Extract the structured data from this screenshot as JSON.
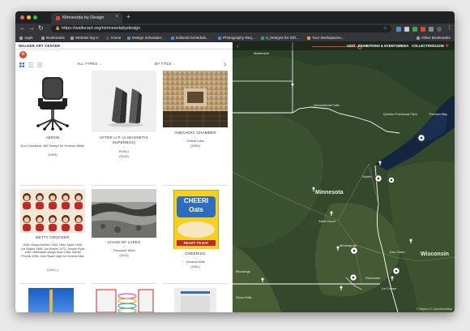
{
  "browser": {
    "tab_title": "Minnesota by Design",
    "url": "https://walkerart.org/minnesotabydesign",
    "bookmarks": [
      "Apps",
      "Bookmarks",
      "Website log in",
      "Home",
      "Design Scheduler...",
      "Editorial Schedule...",
      "Photography Req...",
      "0_Designs for Gift...",
      "Your Workspaces..."
    ],
    "other_bookmarks": "Other Bookmarks"
  },
  "site": {
    "brand": "WALKER ART CENTER",
    "filter_type": "ALL TYPES",
    "filter_sort": "BY TITLE"
  },
  "objects": [
    {
      "title": "AERON",
      "maker": "Don Chadwick, Bill Stumpf for Herman Miller",
      "year": "(1994)"
    },
    {
      "title": "AFTER U.P. (A MAGNETIC SUPERBOX)",
      "maker": "RO/LU",
      "year": "(2013)"
    },
    {
      "title": "ANECHOIC CHAMBER",
      "maker": "Orfield Labs",
      "year": "(1990)"
    },
    {
      "title": "BETTY CROCKER",
      "maker": "1936: Neysa McMein 1955: Hilda Taylor 1965: Joe Bowler 1969: Joe Bowler 1972: Jerome Ryan 1980: Manhattan design team 1986: Harriet Perchik 1996: John Stuart Ingle for General Mills",
      "year": "(1921–)"
    },
    {
      "title": "CHAIN OF LAKES",
      "maker": "Theodore Wirth",
      "year": "(1911)"
    },
    {
      "title": "CHEERIOS",
      "maker": "General Mills",
      "year": "(1941)"
    }
  ],
  "cheerios_box": {
    "brand": "CHEERI",
    "brand2": "Oats",
    "slogan": "READY TO EAT"
  },
  "map": {
    "nav": [
      "VISIT",
      "EXHIBITIONS & EVENTS",
      "MEDIA",
      "COLLECTIONS",
      "JOIN"
    ],
    "places": [
      "Minnesota",
      "Wisconsin",
      "Duluth",
      "Saint Cloud",
      "Minneapolis",
      "Eau Claire",
      "Rochester",
      "La Crosse",
      "Sioux Falls",
      "Brookings",
      "International Falls",
      "Thunder Bay",
      "Quetico Provincial Park"
    ],
    "attribution": "© Mapbox © OpenStreetMap"
  },
  "colors": {
    "accent": "#e8442c",
    "map_base": "#2e4426"
  }
}
